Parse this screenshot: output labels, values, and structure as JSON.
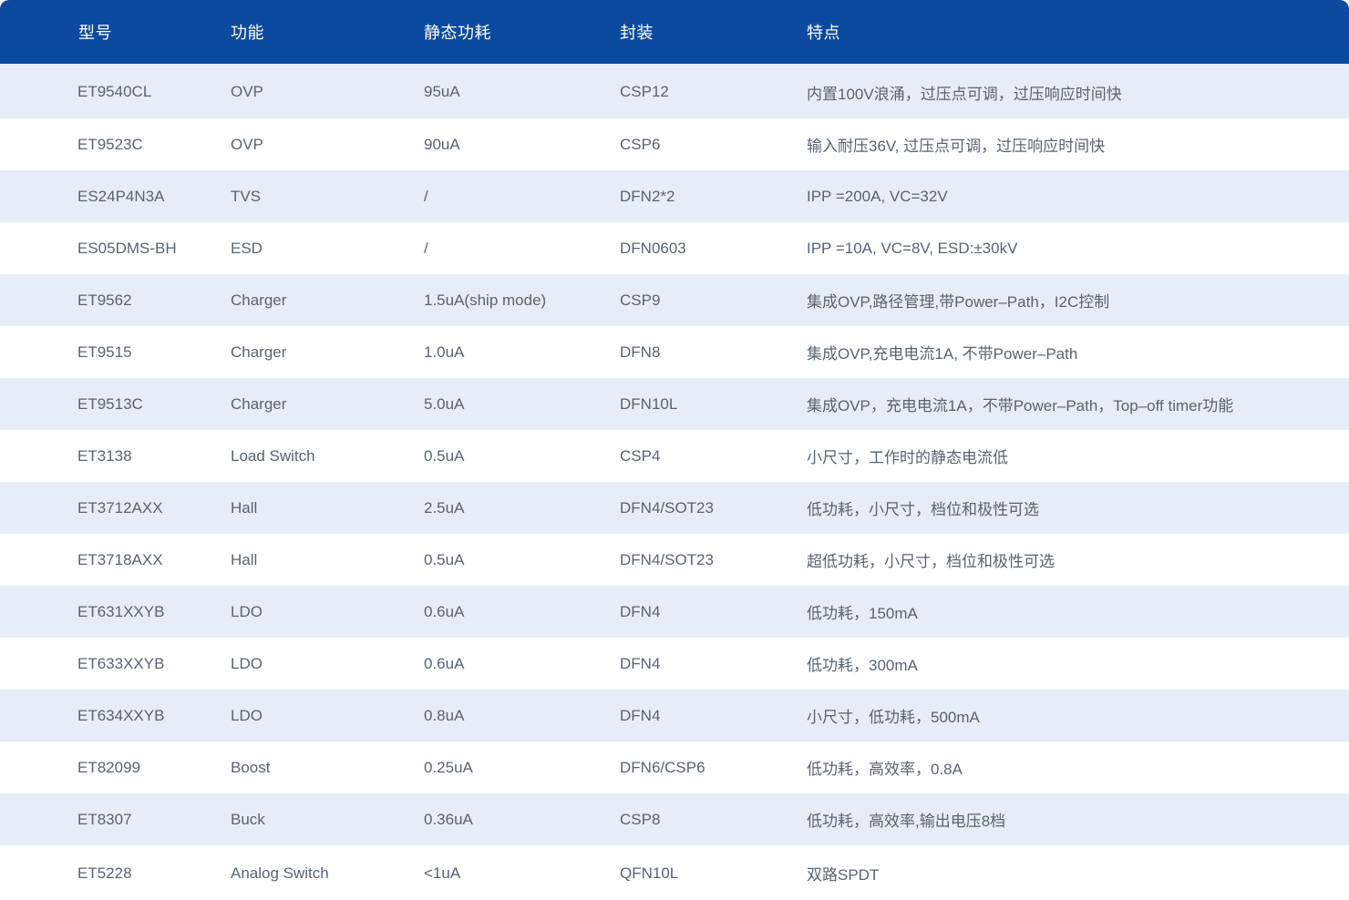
{
  "table": {
    "headers": [
      "型号",
      "功能",
      "静态功耗",
      "封装",
      "特点"
    ],
    "rows": [
      [
        "ET9540CL",
        "OVP",
        "95uA",
        "CSP12",
        "内置100V浪涌，过压点可调，过压响应时间快"
      ],
      [
        "ET9523C",
        "OVP",
        "90uA",
        "CSP6",
        "输入耐压36V, 过压点可调，过压响应时间快"
      ],
      [
        "ES24P4N3A",
        "TVS",
        "/",
        "DFN2*2",
        "IPP =200A, VC=32V"
      ],
      [
        "ES05DMS-BH",
        "ESD",
        "/",
        "DFN0603",
        "IPP =10A, VC=8V, ESD:±30kV"
      ],
      [
        "ET9562",
        "Charger",
        "1.5uA(ship mode)",
        "CSP9",
        "集成OVP,路径管理,带Power–Path，I2C控制"
      ],
      [
        "ET9515",
        "Charger",
        "1.0uA",
        "DFN8",
        "集成OVP,充电电流1A, 不带Power–Path"
      ],
      [
        "ET9513C",
        "Charger",
        "5.0uA",
        "DFN10L",
        "集成OVP，充电电流1A，不带Power–Path，Top–off timer功能"
      ],
      [
        "ET3138",
        "Load Switch",
        "0.5uA",
        "CSP4",
        "小尺寸，工作时的静态电流低"
      ],
      [
        "ET3712AXX",
        "Hall",
        "2.5uA",
        "DFN4/SOT23",
        "低功耗，小尺寸，档位和极性可选"
      ],
      [
        "ET3718AXX",
        "Hall",
        "0.5uA",
        "DFN4/SOT23",
        "超低功耗，小尺寸，档位和极性可选"
      ],
      [
        "ET631XXYB",
        "LDO",
        "0.6uA",
        "DFN4",
        "低功耗，150mA"
      ],
      [
        "ET633XXYB",
        "LDO",
        "0.6uA",
        "DFN4",
        "低功耗，300mA"
      ],
      [
        "ET634XXYB",
        "LDO",
        "0.8uA",
        "DFN4",
        "小尺寸，低功耗，500mA"
      ],
      [
        "ET82099",
        "Boost",
        "0.25uA",
        "DFN6/CSP6",
        "低功耗，高效率，0.8A"
      ],
      [
        "ET8307",
        "Buck",
        "0.36uA",
        "CSP8",
        "低功耗，高效率,输出电压8档"
      ],
      [
        "ET5228",
        "Analog Switch",
        "<1uA",
        "QFN10L",
        "双路SPDT"
      ]
    ]
  },
  "colors": {
    "header_bg": "#0c4aa0",
    "row_alt_bg": "#e6edf6",
    "text": "#5a6372"
  }
}
